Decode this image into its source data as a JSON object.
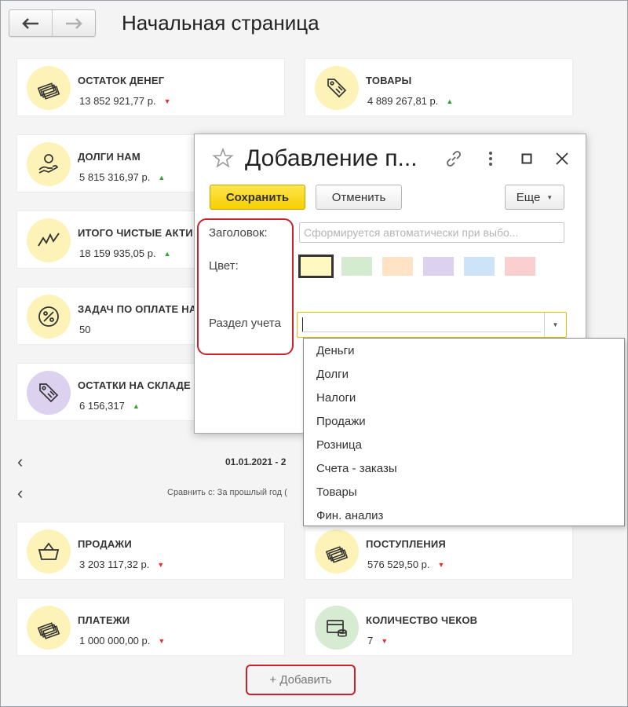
{
  "nav": {
    "back_icon": "arrow-left-icon",
    "forward_icon": "arrow-right-icon"
  },
  "page_title": "Начальная страница",
  "cards": [
    {
      "title": "ОСТАТОК ДЕНЕГ",
      "value": "13 852 921,77 р.",
      "trend": "down",
      "icon": "money-stack-icon",
      "color": "#fdf3b8"
    },
    {
      "title": "ТОВАРЫ",
      "value": "4 889 267,81 р.",
      "trend": "up",
      "icon": "price-tag-icon",
      "color": "#fdf3b8"
    },
    {
      "title": "ДОЛГИ НАМ",
      "value": "5 815 316,97 р.",
      "trend": "up",
      "icon": "hand-coin-icon",
      "color": "#fdf3b8"
    },
    {
      "title": "ИТОГО ЧИСТЫЕ АКТИ",
      "value": "18 159 935,05 р.",
      "trend": "up",
      "icon": "zigzag-chart-icon",
      "color": "#fdf3b8"
    },
    {
      "title": "ЗАДАЧ ПО ОПЛАТЕ НА",
      "value": "50",
      "trend": "",
      "icon": "percent-icon",
      "color": "#fdf3b8"
    },
    {
      "title": "ОСТАТКИ НА СКЛАДЕ",
      "value": "6 156,317",
      "trend": "up",
      "icon": "price-tag-icon",
      "color": "#ddd1f0"
    },
    {
      "title": "ПРОДАЖИ",
      "value": "3 203 117,32 р.",
      "trend": "down",
      "icon": "basket-icon",
      "color": "#fdf3b8"
    },
    {
      "title": "ПОСТУПЛЕНИЯ",
      "value": "576 529,50 р.",
      "trend": "down",
      "icon": "money-stack-icon",
      "color": "#fdf3b8"
    },
    {
      "title": "ПЛАТЕЖИ",
      "value": "1 000 000,00 р.",
      "trend": "down",
      "icon": "money-stack-icon",
      "color": "#fdf3b8"
    },
    {
      "title": "КОЛИЧЕСТВО ЧЕКОВ",
      "value": "7",
      "trend": "down",
      "icon": "register-icon",
      "color": "#d7ebd3"
    }
  ],
  "period": {
    "label": "01.01.2021 - 2",
    "compare": "Сравнить с: За прошлый год ("
  },
  "add_button": "+ Добавить",
  "dialog": {
    "title": "Добавление п...",
    "save": "Сохранить",
    "cancel": "Отменить",
    "more": "Еще",
    "label_title": "Заголовок:",
    "title_placeholder": "Сформируется автоматически при выбо...",
    "label_color": "Цвет:",
    "label_section": "Раздел учета",
    "section_value": "",
    "swatches": [
      "#fff8c0",
      "#d4ebd0",
      "#ffe3c4",
      "#ddd1f0",
      "#cde3f8",
      "#f9cfcf"
    ],
    "selected_swatch": 0
  },
  "dropdown_options": [
    "Деньги",
    "Долги",
    "Налоги",
    "Продажи",
    "Розница",
    "Счета - заказы",
    "Товары",
    "Фин. анализ"
  ]
}
